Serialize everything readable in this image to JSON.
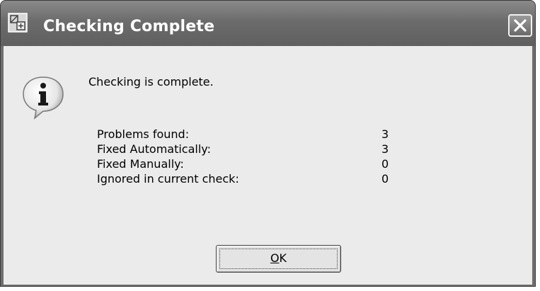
{
  "window": {
    "title": "Checking Complete"
  },
  "dialog": {
    "message": "Checking is complete.",
    "stats": [
      {
        "label": "Problems found:",
        "value": "3"
      },
      {
        "label": "Fixed Automatically:",
        "value": "3"
      },
      {
        "label": "Fixed Manually:",
        "value": "0"
      },
      {
        "label": "Ignored in current check:",
        "value": "0"
      }
    ],
    "ok_mnemonic": "O",
    "ok_rest": "K"
  },
  "icons": {
    "app": "drawing-app-icon",
    "info": "info-icon",
    "close": "close-icon"
  }
}
